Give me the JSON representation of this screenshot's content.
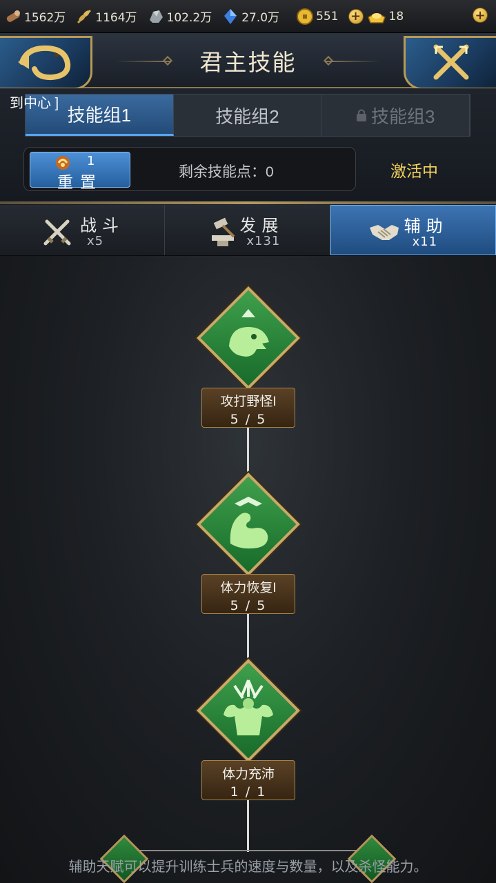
{
  "resources": [
    {
      "icon": "wood-log-icon",
      "value": "1562万"
    },
    {
      "icon": "wheat-icon",
      "value": "1164万"
    },
    {
      "icon": "stone-ore-icon",
      "value": "102.2万"
    },
    {
      "icon": "crystal-icon",
      "value": "27.0万"
    },
    {
      "icon": "gold-coin-icon",
      "value": "551"
    }
  ],
  "premium": {
    "icon": "gold-ingot-icon",
    "value": "18"
  },
  "header": {
    "title": "君主技能"
  },
  "ticker": "到中心 ]",
  "skill_groups": [
    {
      "label": "技能组1",
      "state": "active"
    },
    {
      "label": "技能组2",
      "state": "normal"
    },
    {
      "label": "技能组3",
      "state": "locked"
    }
  ],
  "reset": {
    "count": "1",
    "label": "重置"
  },
  "points": {
    "text": "剩余技能点：0"
  },
  "status": "激活中",
  "categories": [
    {
      "icon": "crossed-swords-icon",
      "label": "战斗",
      "count": "x5"
    },
    {
      "icon": "hammer-anvil-icon",
      "label": "发展",
      "count": "x131"
    },
    {
      "icon": "handshake-icon",
      "label": "辅助",
      "count": "x11",
      "active": true
    }
  ],
  "skills": [
    {
      "icon": "monster-head-icon",
      "name": "攻打野怪I",
      "level": "5 / 5"
    },
    {
      "icon": "flexed-arm-icon",
      "name": "体力恢复I",
      "level": "5 / 5"
    },
    {
      "icon": "strong-man-icon",
      "name": "体力充沛",
      "level": "1 / 1"
    }
  ],
  "hint": "辅助天赋可以提升训练士兵的速度与数量，以及杀怪能力。",
  "colors": {
    "accent_blue": "#3d74b3",
    "gold_border": "#c7a969",
    "skill_green": "#3fa04c",
    "status_yellow": "#f4d35b"
  }
}
